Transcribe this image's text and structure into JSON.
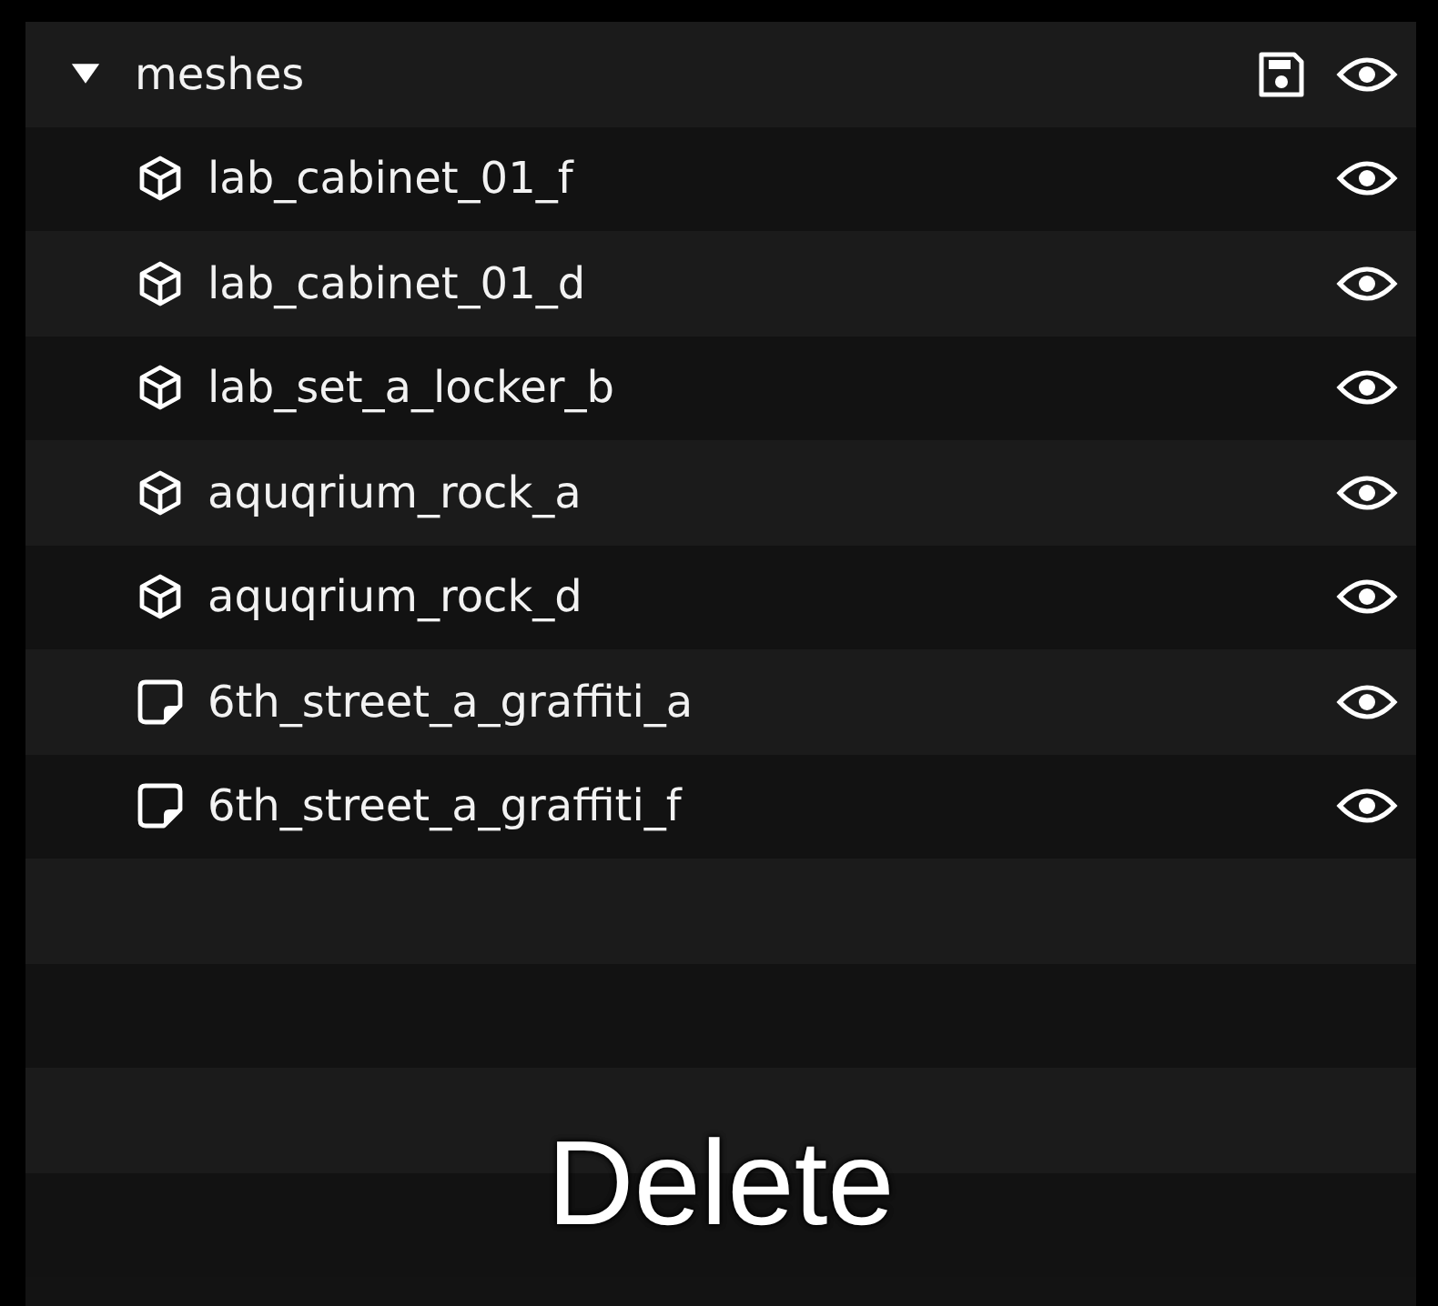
{
  "group": {
    "label": "meshes",
    "expanded": true,
    "children": [
      {
        "label": "lab_cabinet_01_f",
        "kind": "mesh"
      },
      {
        "label": "lab_cabinet_01_d",
        "kind": "mesh"
      },
      {
        "label": "lab_set_a_locker_b",
        "kind": "mesh"
      },
      {
        "label": "aquqrium_rock_a",
        "kind": "mesh"
      },
      {
        "label": "aquqrium_rock_d",
        "kind": "mesh"
      },
      {
        "label": "6th_street_a_graffiti_a",
        "kind": "decal"
      },
      {
        "label": "6th_street_a_graffiti_f",
        "kind": "decal"
      }
    ]
  },
  "caption": "Delete"
}
